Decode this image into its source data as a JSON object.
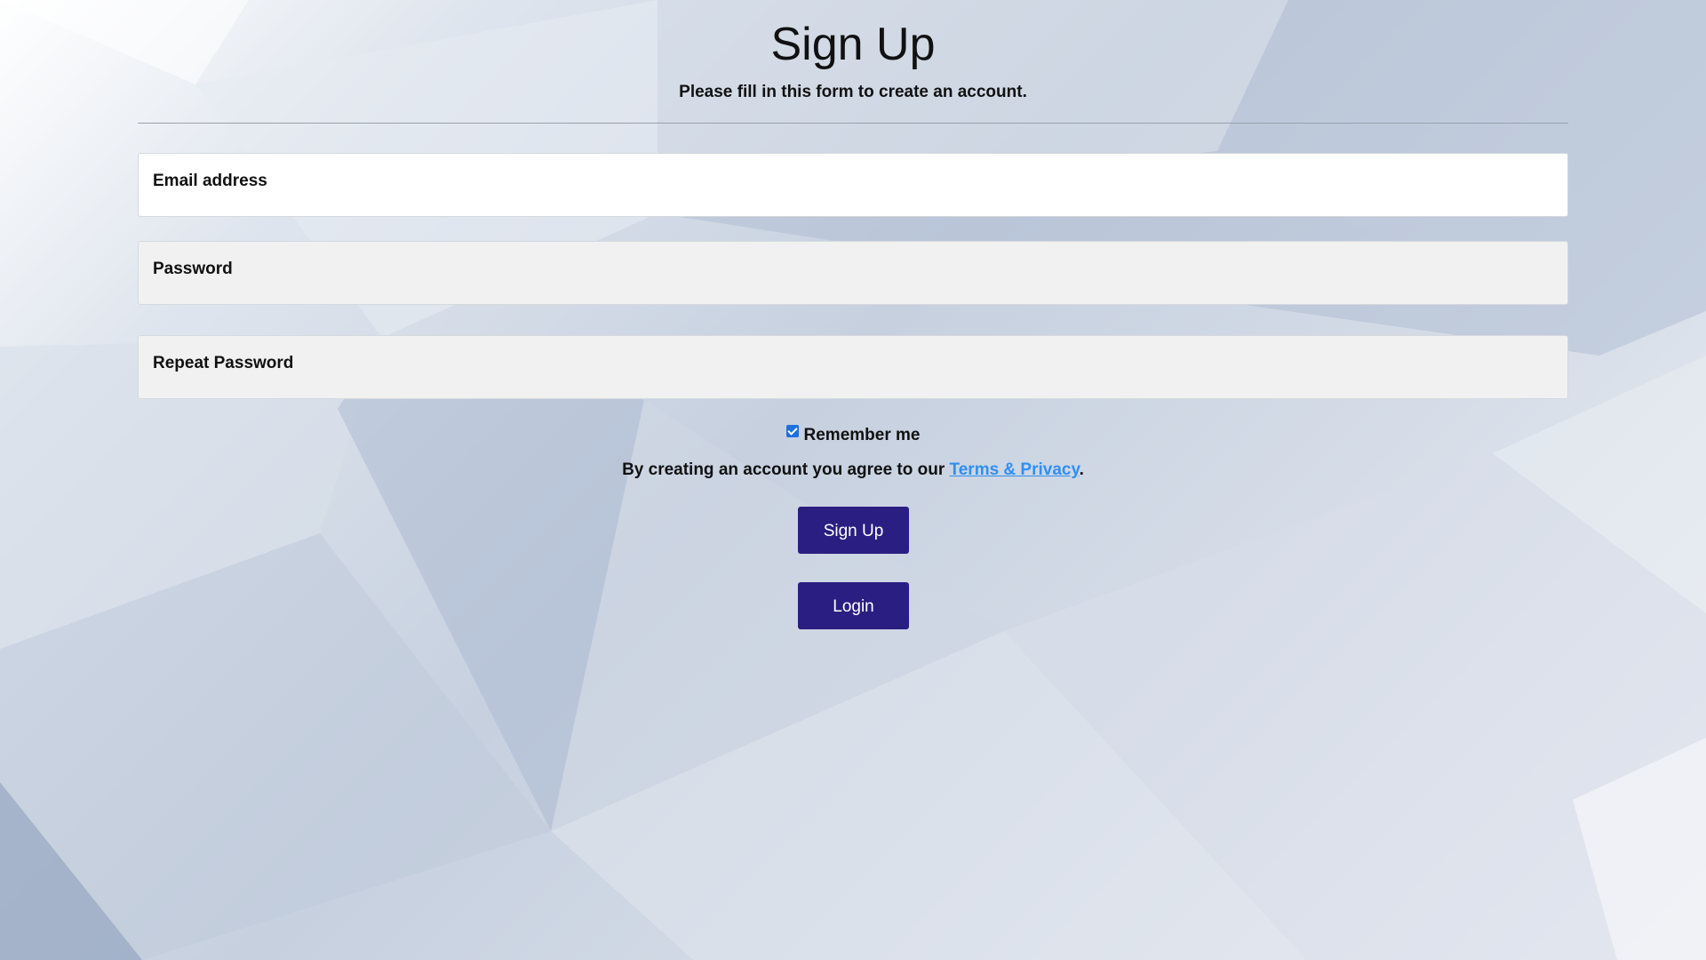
{
  "header": {
    "title": "Sign Up",
    "subtitle": "Please fill in this form to create an account."
  },
  "form": {
    "email_label": "Email address",
    "password_label": "Password",
    "repeat_password_label": "Repeat Password",
    "email_value": "",
    "password_value": "",
    "repeat_password_value": ""
  },
  "remember": {
    "label": "Remember me",
    "checked": true
  },
  "agreement": {
    "text_before": "By creating an account you agree to our ",
    "link_text": "Terms & Privacy",
    "text_after": "."
  },
  "buttons": {
    "signup_label": "Sign Up",
    "login_label": "Login"
  },
  "colors": {
    "button_bg": "#2a1e82",
    "link": "#2f8ff2",
    "checkbox": "#1e6fe0"
  },
  "icons": {
    "checkbox": "checkbox-checked-icon"
  }
}
